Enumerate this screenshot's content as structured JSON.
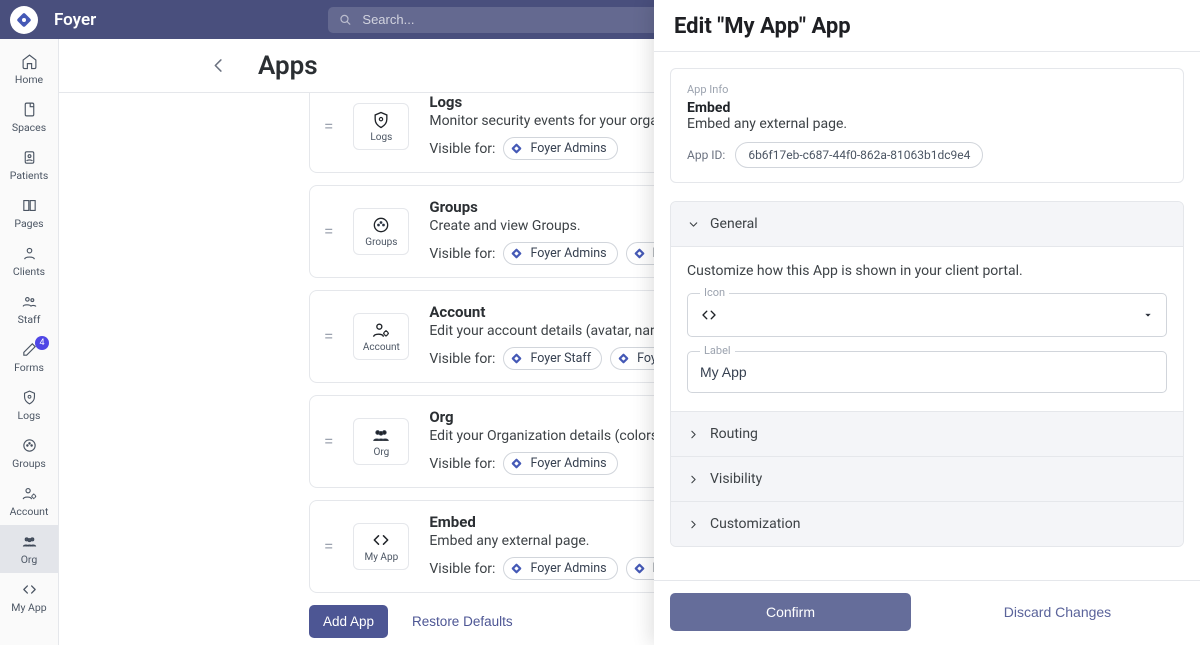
{
  "brand": {
    "name": "Foyer"
  },
  "search": {
    "placeholder": "Search..."
  },
  "nav": {
    "items": [
      {
        "id": "home",
        "label": "Home",
        "icon": "home-icon"
      },
      {
        "id": "spaces",
        "label": "Spaces",
        "icon": "spaces-icon"
      },
      {
        "id": "patients",
        "label": "Patients",
        "icon": "badge-icon"
      },
      {
        "id": "pages",
        "label": "Pages",
        "icon": "book-icon"
      },
      {
        "id": "clients",
        "label": "Clients",
        "icon": "person-icon"
      },
      {
        "id": "staff",
        "label": "Staff",
        "icon": "group-icon"
      },
      {
        "id": "forms",
        "label": "Forms",
        "icon": "edit-icon",
        "badge": "4"
      },
      {
        "id": "logs",
        "label": "Logs",
        "icon": "shield-icon"
      },
      {
        "id": "groups",
        "label": "Groups",
        "icon": "dots-circle-icon"
      },
      {
        "id": "account",
        "label": "Account",
        "icon": "person-gear-icon"
      },
      {
        "id": "org",
        "label": "Org",
        "icon": "people-icon",
        "selected": true
      },
      {
        "id": "myapp",
        "label": "My App",
        "icon": "code-icon"
      }
    ]
  },
  "page": {
    "title": "Apps"
  },
  "visible_for_label": "Visible for:",
  "apps": [
    {
      "id": "logs",
      "title": "Logs",
      "icon": "shield-icon",
      "iconLabel": "Logs",
      "desc": "Monitor security events for your organization.",
      "tags": [
        "Foyer Admins"
      ]
    },
    {
      "id": "groups",
      "title": "Groups",
      "icon": "dots-circle-icon",
      "iconLabel": "Groups",
      "desc": "Create and view Groups.",
      "tags": [
        "Foyer Admins",
        "Foyer Staff"
      ]
    },
    {
      "id": "account",
      "title": "Account",
      "icon": "person-gear-icon",
      "iconLabel": "Account",
      "desc": "Edit your account details (avatar, name, phone number, etc).",
      "tags": [
        "Foyer Staff",
        "Foyer Admins"
      ]
    },
    {
      "id": "org",
      "title": "Org",
      "icon": "people-icon",
      "iconLabel": "Org",
      "desc": "Edit your Organization details (colors, logo, settings, etc).",
      "tags": [
        "Foyer Admins"
      ]
    },
    {
      "id": "embed",
      "title": "Embed",
      "icon": "code-icon",
      "iconLabel": "My App",
      "desc": "Embed any external page.",
      "tags": [
        "Foyer Admins",
        "Foyer Staff"
      ]
    }
  ],
  "actions": {
    "add": "Add App",
    "restore": "Restore Defaults"
  },
  "drawer": {
    "title": "Edit \"My App\" App",
    "app_info": {
      "section_label": "App Info",
      "title": "Embed",
      "desc": "Embed any external page.",
      "appid_label": "App ID:",
      "appid": "6b6f17eb-c687-44f0-862a-81063b1dc9e4"
    },
    "sections": {
      "general": "General",
      "general_help": "Customize how this App is shown in your client portal.",
      "icon_label": "Icon",
      "label_label": "Label",
      "label_value": "My App",
      "routing": "Routing",
      "visibility": "Visibility",
      "customization": "Customization"
    },
    "buttons": {
      "confirm": "Confirm",
      "discard": "Discard Changes"
    }
  }
}
